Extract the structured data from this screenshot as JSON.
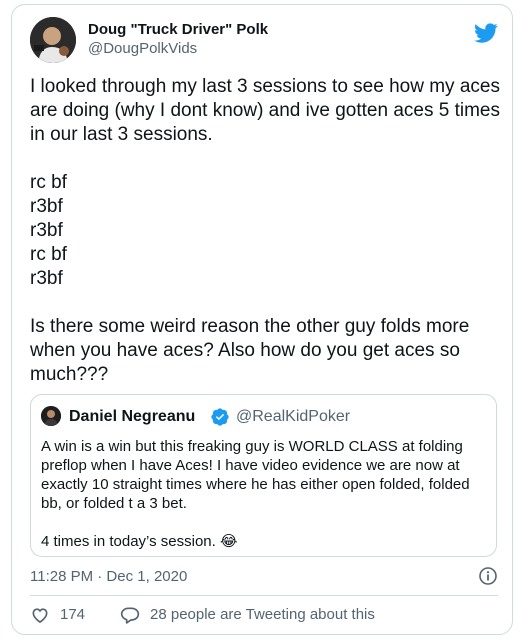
{
  "tweet": {
    "display_name": "Doug \"Truck Driver\" Polk",
    "handle": "@DougPolkVids",
    "paragraphs": [
      "I looked through my last 3 sessions to see how my aces are doing (why I dont know) and ive gotten aces 5 times in our last 3 sessions.",
      "rc bf",
      "r3bf",
      "r3bf",
      "rc bf",
      "r3bf",
      "Is there some weird reason the other guy folds more when you have aces? Also how do you get aces so much???"
    ],
    "timestamp": "11:28 PM · Dec 1, 2020",
    "likes": "174",
    "replies_text": "28 people are Tweeting about this"
  },
  "quote": {
    "display_name": "Daniel Negreanu",
    "handle": "@RealKidPoker",
    "text": "A win is a win but this freaking guy is WORLD CLASS at folding preflop when I have Aces! I have video evidence we are now at exactly 10 straight times where he has either open folded, folded bb, or folded t a 3 bet.",
    "text2": "4 times in today’s session. 😂"
  },
  "colors": {
    "twitter_blue": "#1d9bf0",
    "secondary_text": "#536471",
    "border": "#cfd9de"
  },
  "icons": {
    "brand": "twitter-bird-icon",
    "verified": "verified-badge-icon",
    "info": "info-icon",
    "like": "heart-icon",
    "reply": "speech-bubble-icon"
  }
}
